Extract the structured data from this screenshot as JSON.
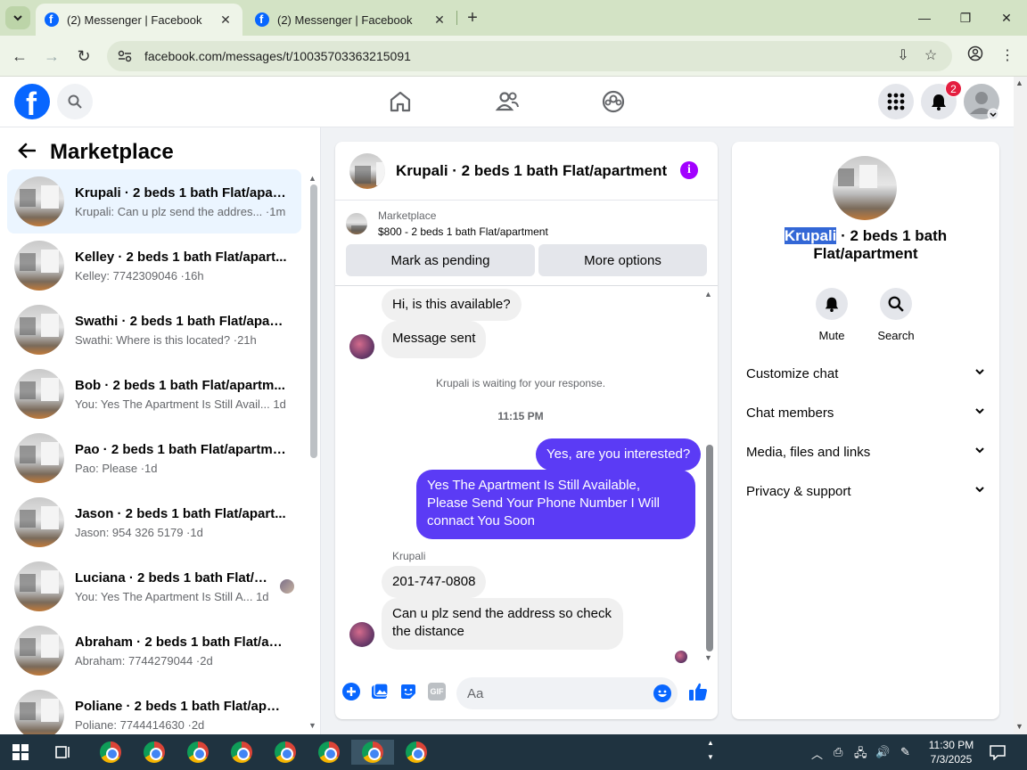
{
  "browser": {
    "tabs": [
      {
        "label": "(2) Messenger | Facebook",
        "active": true
      },
      {
        "label": "(2) Messenger | Facebook",
        "active": false
      }
    ],
    "new_tab": "+",
    "url": "facebook.com/messages/t/10035703363215091"
  },
  "fb": {
    "notification_count": "2"
  },
  "marketplace": {
    "title": "Marketplace",
    "conversations": [
      {
        "name": "Krupali · 2 beds 1 bath Flat/apar...",
        "snippet": "Krupali: Can u plz send the addres... ·1m",
        "selected": true
      },
      {
        "name": "Kelley · 2 beds 1 bath Flat/apart...",
        "snippet": "Kelley: 7742309046 ·16h"
      },
      {
        "name": "Swathi · 2 beds 1 bath Flat/apart...",
        "snippet": "Swathi: Where is this located? ·21h"
      },
      {
        "name": "Bob · 2 beds 1 bath Flat/apartm...",
        "snippet": "You: Yes The Apartment Is Still Avail...  1d"
      },
      {
        "name": "Pao · 2 beds 1 bath Flat/apartme...",
        "snippet": "Pao: Please ·1d"
      },
      {
        "name": "Jason · 2 beds 1 bath Flat/apart...",
        "snippet": "Jason: 954 326 5179 ·1d"
      },
      {
        "name": "Luciana · 2 beds 1 bath Flat/a...",
        "snippet": "You: Yes The Apartment Is Still A...  1d",
        "seen_avatar": true
      },
      {
        "name": "Abraham · 2 beds 1 bath Flat/ap...",
        "snippet": "Abraham: 7744279044 ·2d"
      },
      {
        "name": "Poliane · 2 beds 1 bath Flat/apar...",
        "snippet": "Poliane: 7744414630 ·2d"
      }
    ]
  },
  "chat": {
    "title": "Krupali · 2 beds 1 bath Flat/apartment",
    "marketplace_label": "Marketplace",
    "listing": "$800 - 2 beds 1 bath Flat/apartment",
    "mark_pending": "Mark as pending",
    "more_options": "More options",
    "messages": {
      "m1": "Hi, is this available?",
      "m2": "Message sent",
      "waiting": "Krupali is waiting for your response.",
      "time": "11:15 PM",
      "o1": "Yes, are you interested?",
      "o2": "Yes The Apartment Is Still Available, Please Send Your Phone Number I Will connact You Soon",
      "sender": "Krupali",
      "m3": "201-747-0808",
      "m4": "Can u plz send the address so check the distance"
    },
    "composer_placeholder": "Aa",
    "gif": "GIF"
  },
  "info": {
    "name_highlight": "Krupali",
    "name_rest": " · 2 beds 1 bath Flat/apartment",
    "mute": "Mute",
    "search": "Search",
    "sections": [
      "Customize chat",
      "Chat members",
      "Media, files and links",
      "Privacy & support"
    ]
  },
  "taskbar": {
    "time": "11:30 PM",
    "date": "7/3/2025"
  }
}
